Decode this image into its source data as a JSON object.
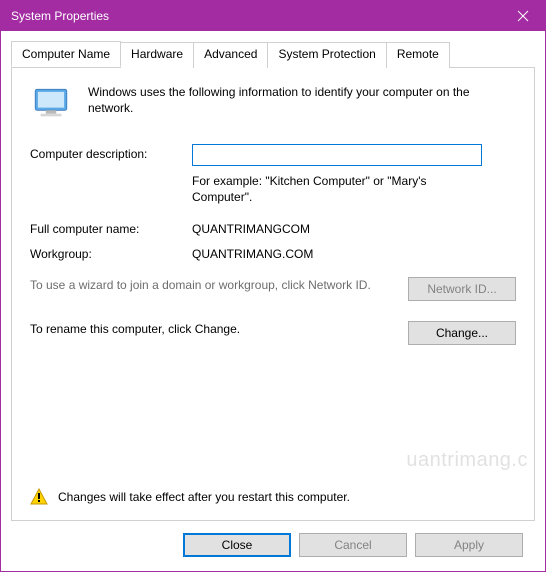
{
  "window": {
    "title": "System Properties"
  },
  "tabs": [
    {
      "label": "Computer Name",
      "active": true
    },
    {
      "label": "Hardware",
      "active": false
    },
    {
      "label": "Advanced",
      "active": false
    },
    {
      "label": "System Protection",
      "active": false
    },
    {
      "label": "Remote",
      "active": false
    }
  ],
  "intro": "Windows uses the following information to identify your computer on the network.",
  "description": {
    "label": "Computer description:",
    "value": "",
    "example": "For example: \"Kitchen Computer\" or \"Mary's Computer\"."
  },
  "fullname": {
    "label": "Full computer name:",
    "value": "QUANTRIMANGCOM"
  },
  "workgroup": {
    "label": "Workgroup:",
    "value": "QUANTRIMANG.COM"
  },
  "networkid": {
    "text": "To use a wizard to join a domain or workgroup, click Network ID.",
    "button": "Network ID..."
  },
  "change": {
    "text": "To rename this computer, click Change.",
    "button": "Change..."
  },
  "restart_notice": "Changes will take effect after you restart this computer.",
  "buttons": {
    "close": "Close",
    "cancel": "Cancel",
    "apply": "Apply"
  },
  "watermark": "uantrimang.c"
}
